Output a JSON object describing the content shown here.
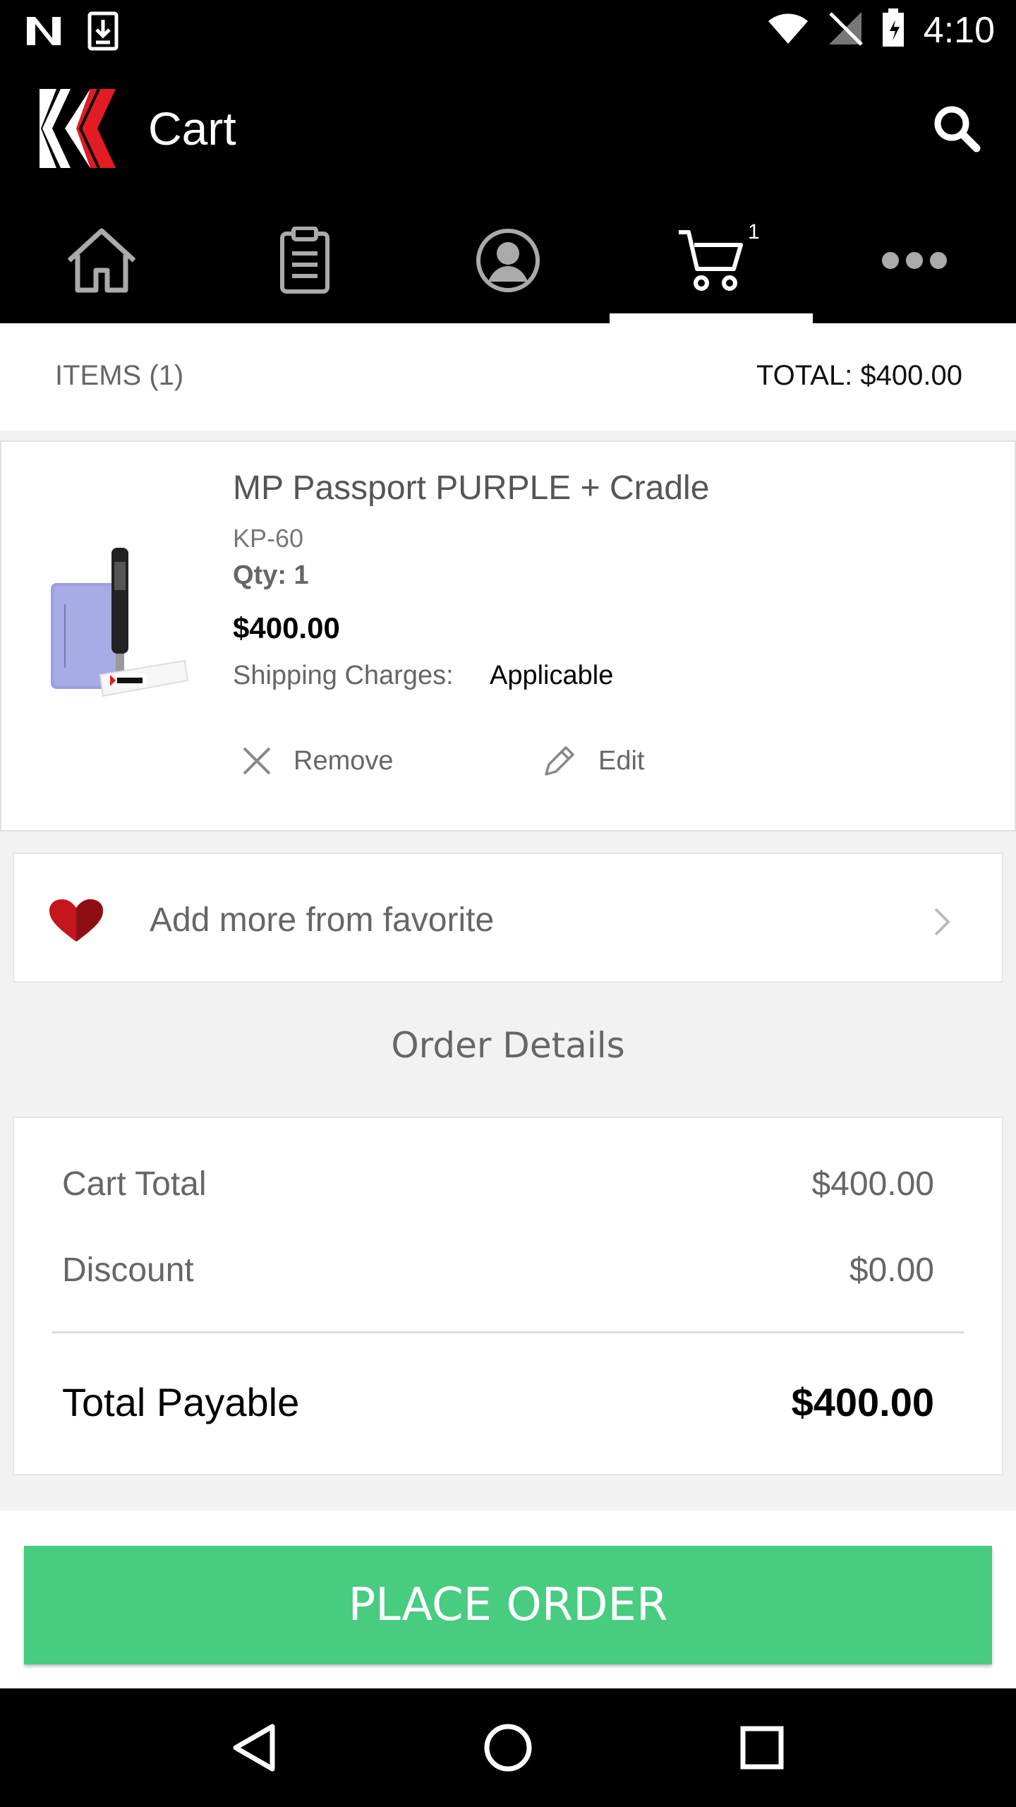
{
  "status_bar": {
    "time": "4:10"
  },
  "app_bar": {
    "title": "Cart"
  },
  "nav_tabs": [
    {
      "icon": "home-icon"
    },
    {
      "icon": "orders-icon"
    },
    {
      "icon": "account-icon"
    },
    {
      "icon": "cart-icon",
      "active": true,
      "badge": "1"
    },
    {
      "icon": "more-icon"
    }
  ],
  "items_header": {
    "count_label": "ITEMS (1)",
    "total_label": "TOTAL: $400.00"
  },
  "product": {
    "name": "MP Passport PURPLE + Cradle",
    "sku": "KP-60",
    "qty_label": "Qty: 1",
    "price": "$400.00",
    "shipping_label": "Shipping Charges:",
    "shipping_value": "Applicable",
    "remove_label": "Remove",
    "edit_label": "Edit"
  },
  "favorites": {
    "label": "Add more from favorite"
  },
  "order_details": {
    "heading": "Order Details",
    "cart_total_label": "Cart Total",
    "cart_total_value": "$400.00",
    "discount_label": "Discount",
    "discount_value": "$0.00",
    "total_payable_label": "Total Payable",
    "total_payable_value": "$400.00"
  },
  "place_order": {
    "label": "PLACE ORDER"
  },
  "colors": {
    "accent_green": "#47cc80",
    "logo_red": "#e31b23"
  }
}
